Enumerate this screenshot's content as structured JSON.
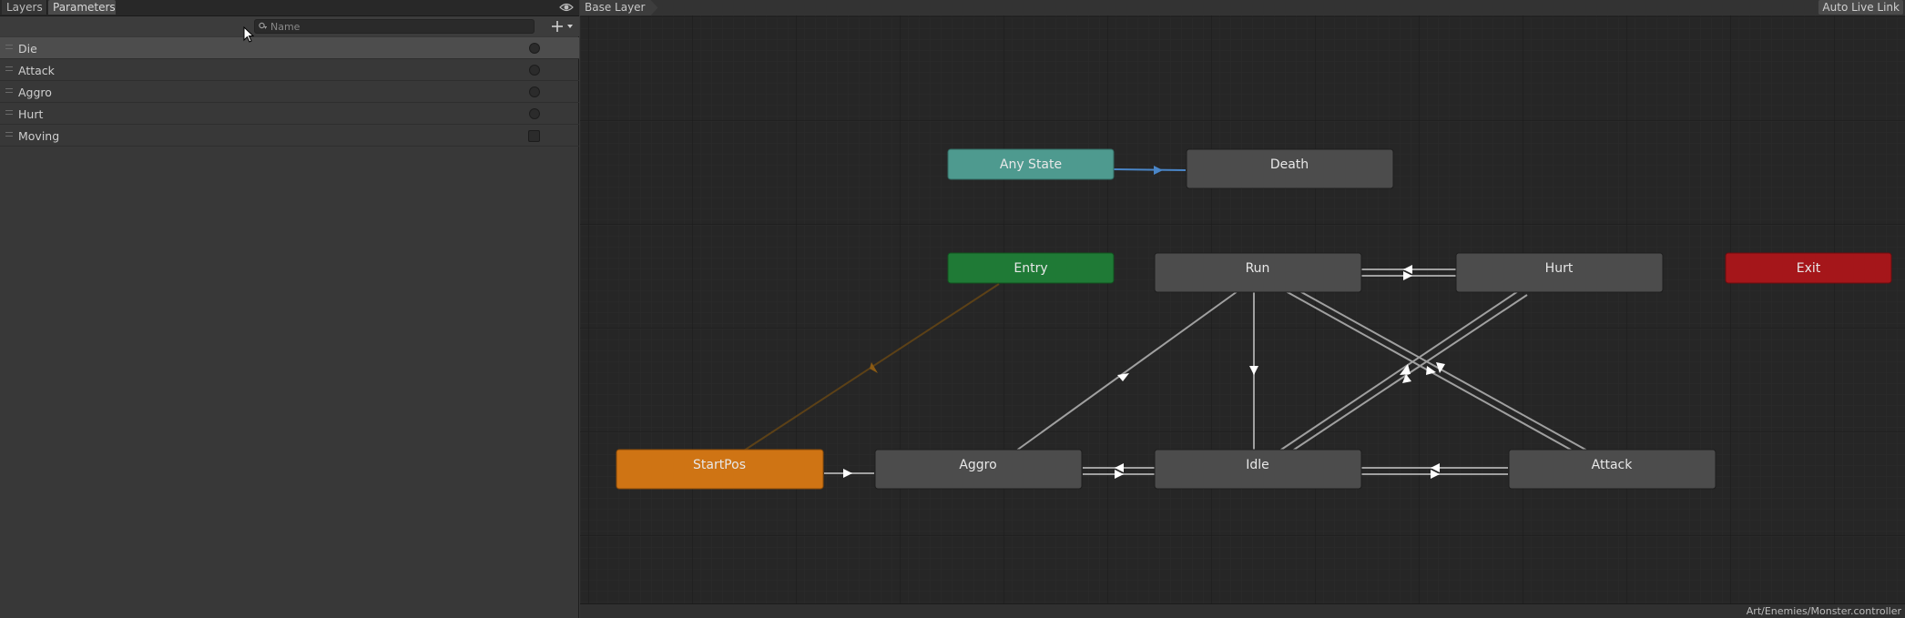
{
  "tabs": [
    {
      "label": "Layers"
    },
    {
      "label": "Parameters"
    }
  ],
  "search": {
    "placeholder": "Name",
    "value": ""
  },
  "parameters": [
    {
      "name": "Die",
      "type": "trigger"
    },
    {
      "name": "Attack",
      "type": "trigger"
    },
    {
      "name": "Aggro",
      "type": "trigger"
    },
    {
      "name": "Hurt",
      "type": "trigger"
    },
    {
      "name": "Moving",
      "type": "bool"
    }
  ],
  "graph": {
    "breadcrumb": "Base Layer",
    "auto_live_link": "Auto Live Link",
    "asset_path": "Art/Enemies/Monster.controller",
    "states": {
      "any_state": "Any State",
      "death": "Death",
      "entry": "Entry",
      "run": "Run",
      "hurt": "Hurt",
      "exit": "Exit",
      "startpos": "StartPos",
      "aggro": "Aggro",
      "idle": "Idle",
      "attack": "Attack"
    }
  },
  "colors": {
    "any_state": "#4e9a8f",
    "entry": "#1f7a36",
    "exit": "#a5161a",
    "default_state": "#cf7414",
    "state": "#4c4c4c"
  }
}
